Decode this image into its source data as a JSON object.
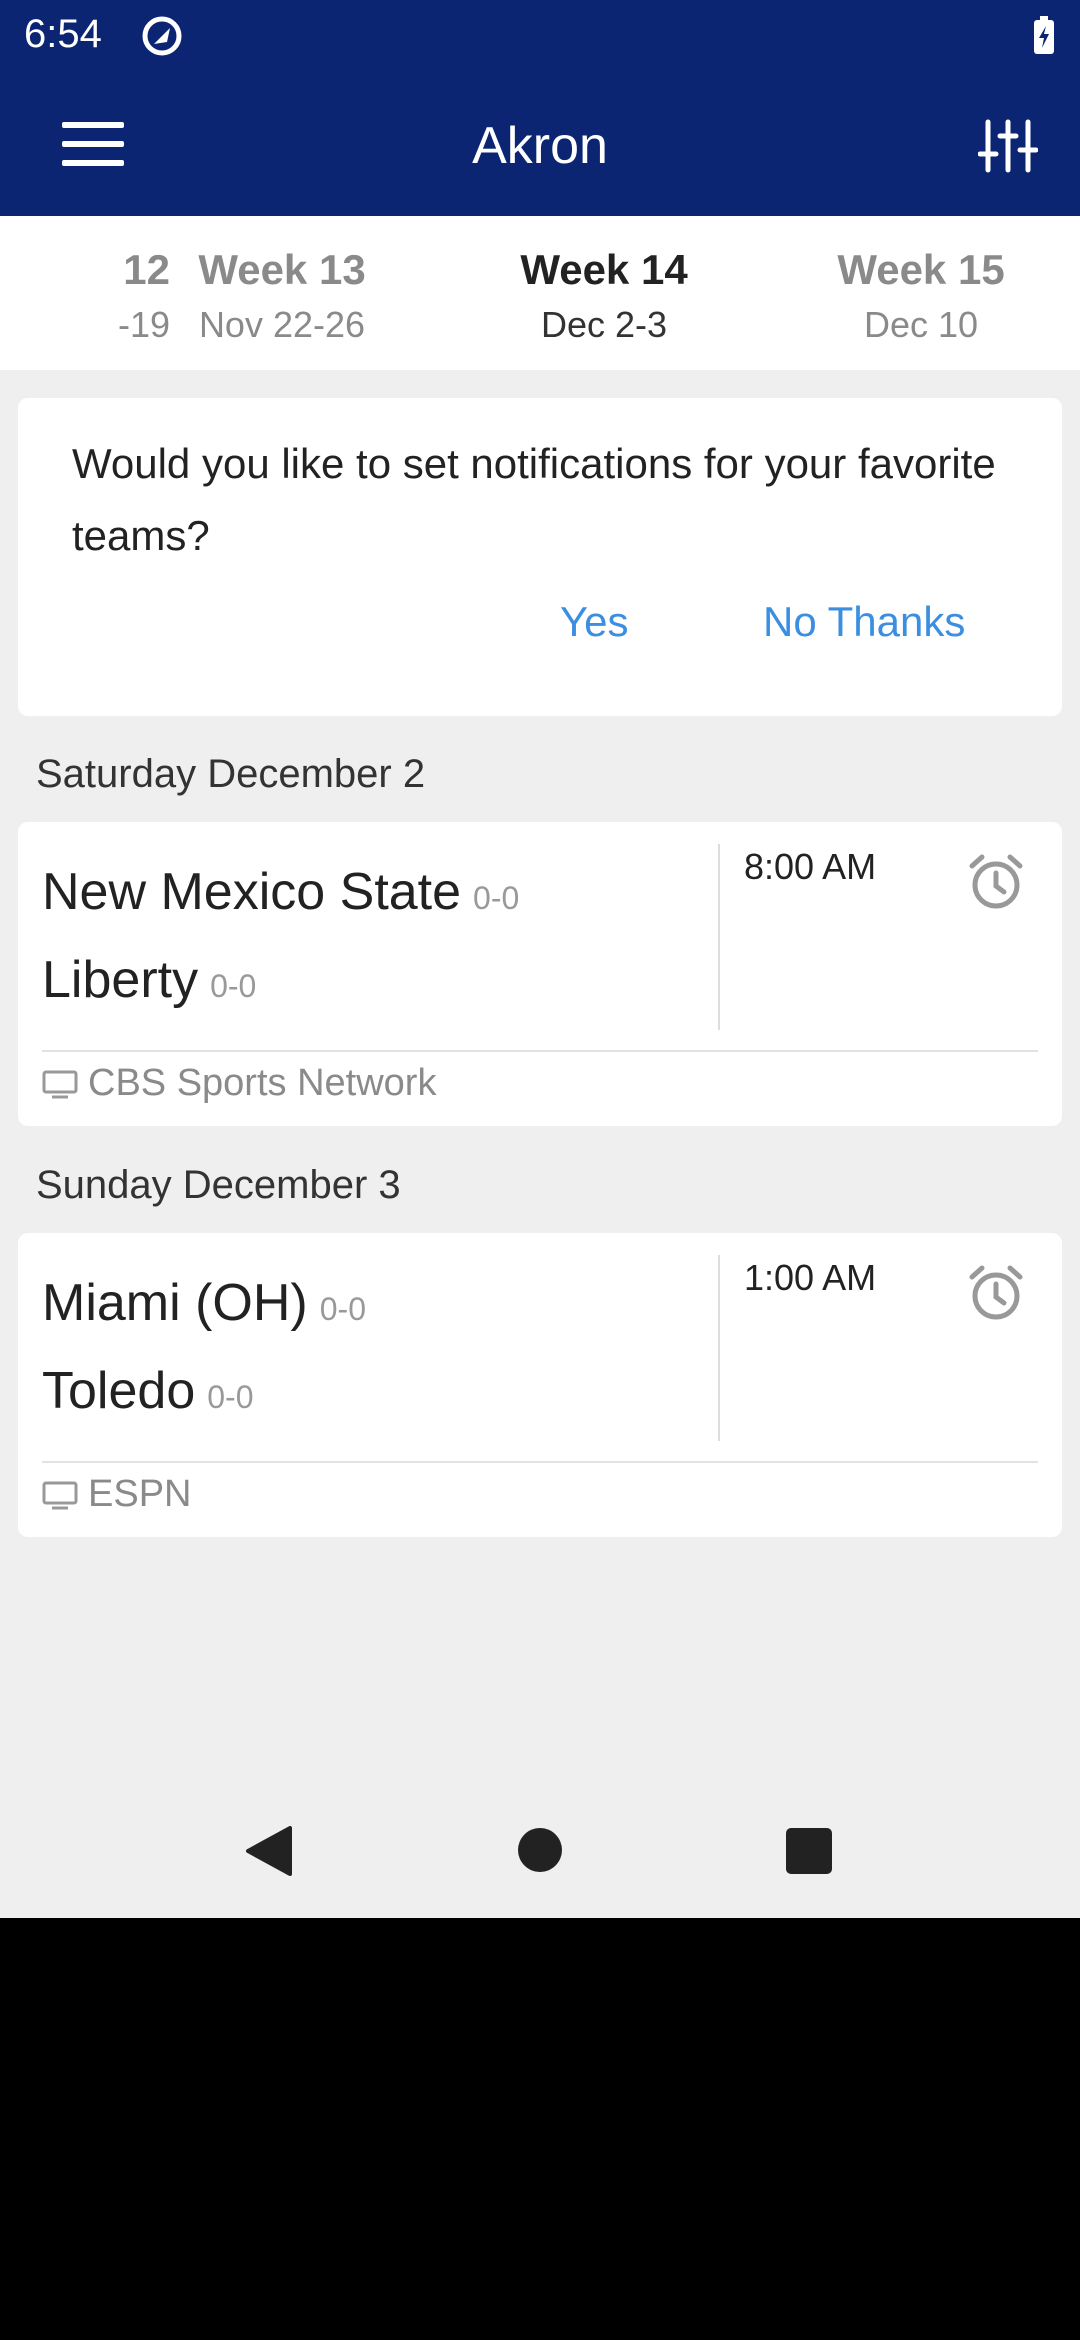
{
  "status_bar": {
    "time": "6:54"
  },
  "app_bar": {
    "title": "Akron"
  },
  "weeks": [
    {
      "week": "12",
      "dates": "-19",
      "active": false
    },
    {
      "week": "Week 13",
      "dates": "Nov 22-26",
      "active": false
    },
    {
      "week": "Week 14",
      "dates": "Dec 2-3",
      "active": true
    },
    {
      "week": "Week 15",
      "dates": "Dec 10",
      "active": false
    }
  ],
  "notification_prompt": {
    "text": "Would you like to set notifications for your favorite teams?",
    "yes_label": "Yes",
    "no_label": "No Thanks"
  },
  "days": [
    {
      "header": "Saturday December 2",
      "game": {
        "team1": "New Mexico State",
        "team1_record": "0-0",
        "team2": "Liberty",
        "team2_record": "0-0",
        "time": "8:00 AM",
        "network": "CBS Sports Network"
      }
    },
    {
      "header": "Sunday December 3",
      "game": {
        "team1": "Miami (OH)",
        "team1_record": "0-0",
        "team2": "Toledo",
        "team2_record": "0-0",
        "time": "1:00 AM",
        "network": "ESPN"
      }
    }
  ],
  "icons": {
    "status": "location-ring-icon",
    "battery": "battery-charging-icon",
    "menu": "hamburger-menu-icon",
    "filter": "sliders-icon",
    "alarm": "alarm-clock-icon",
    "tv": "tv-icon"
  },
  "colors": {
    "brand": "#0b2572",
    "accent": "#3b8ee0",
    "background": "#efefef"
  }
}
